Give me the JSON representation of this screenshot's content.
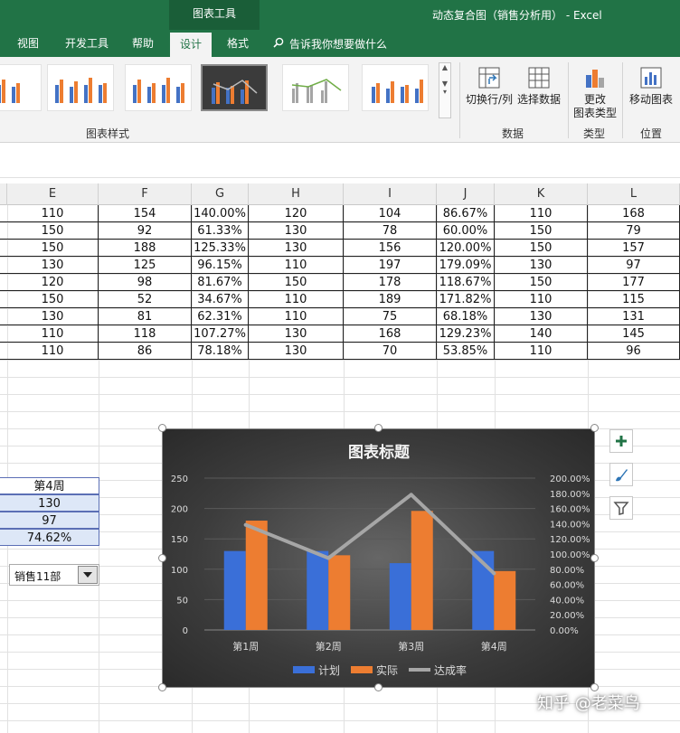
{
  "titlebar": {
    "context_tool": "图表工具",
    "window_title": "动态复合图（销售分析用） - Excel"
  },
  "tabs": [
    {
      "label": "视图"
    },
    {
      "label": "开发工具"
    },
    {
      "label": "帮助"
    },
    {
      "label": "设计"
    },
    {
      "label": "格式"
    }
  ],
  "tell_me": "告诉我你想要做什么",
  "ribbon": {
    "styles_label": "图表样式",
    "data_group": {
      "label": "数据",
      "switch": "切换行/列",
      "select": "选择数据"
    },
    "type_group": {
      "label": "类型",
      "change_line1": "更改",
      "change_line2": "图表类型"
    },
    "position_group": {
      "label": "位置",
      "move": "移动图表"
    }
  },
  "columns": [
    "E",
    "F",
    "G",
    "H",
    "I",
    "J",
    "K",
    "L"
  ],
  "table_rows": [
    [
      "110",
      "154",
      "140.00%",
      "120",
      "104",
      "86.67%",
      "110",
      "168"
    ],
    [
      "150",
      "92",
      "61.33%",
      "130",
      "78",
      "60.00%",
      "150",
      "79"
    ],
    [
      "150",
      "188",
      "125.33%",
      "130",
      "156",
      "120.00%",
      "150",
      "157"
    ],
    [
      "130",
      "125",
      "96.15%",
      "110",
      "197",
      "179.09%",
      "130",
      "97"
    ],
    [
      "120",
      "98",
      "81.67%",
      "150",
      "178",
      "118.67%",
      "150",
      "177"
    ],
    [
      "150",
      "52",
      "34.67%",
      "110",
      "189",
      "171.82%",
      "110",
      "115"
    ],
    [
      "130",
      "81",
      "62.31%",
      "110",
      "75",
      "68.18%",
      "130",
      "131"
    ],
    [
      "110",
      "118",
      "107.27%",
      "130",
      "168",
      "129.23%",
      "140",
      "145"
    ],
    [
      "110",
      "86",
      "78.18%",
      "130",
      "70",
      "53.85%",
      "110",
      "96"
    ]
  ],
  "summary": {
    "header": "第4周",
    "plan": "130",
    "actual": "97",
    "rate": "74.62%"
  },
  "dropdown": {
    "value": "销售11部"
  },
  "chart_data": {
    "type": "bar",
    "title": "图表标题",
    "categories": [
      "第1周",
      "第2周",
      "第3周",
      "第4周"
    ],
    "series": [
      {
        "name": "计划",
        "kind": "bar",
        "color": "#3a6fd8",
        "values": [
          130,
          130,
          110,
          130
        ]
      },
      {
        "name": "实际",
        "kind": "bar",
        "color": "#ed7d31",
        "values": [
          180,
          123,
          196,
          97
        ]
      },
      {
        "name": "达成率",
        "kind": "line",
        "axis": "right",
        "color": "#a6a6a6",
        "values": [
          1.3846,
          0.9462,
          1.7818,
          0.7462
        ]
      }
    ],
    "ylim": [
      0,
      250
    ],
    "y_ticks": [
      "0",
      "50",
      "100",
      "150",
      "200",
      "250"
    ],
    "y2lim": [
      0,
      2
    ],
    "y2_ticks": [
      "0.00%",
      "20.00%",
      "40.00%",
      "60.00%",
      "80.00%",
      "100.00%",
      "120.00%",
      "140.00%",
      "160.00%",
      "180.00%",
      "200.00%"
    ],
    "legend": "bottom"
  },
  "watermark": "知乎 @老菜鸟",
  "colors": {
    "excel_green": "#217346",
    "selection_border": "#5b6fb5"
  }
}
